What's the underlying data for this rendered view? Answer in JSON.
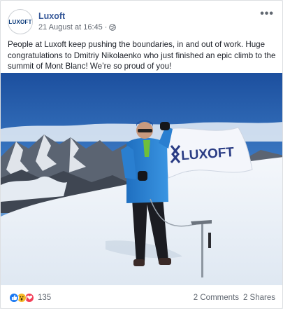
{
  "post": {
    "page_name": "Luxoft",
    "avatar_text": "LUXOFT",
    "timestamp": "21 August at 16:45",
    "separator": "·",
    "privacy_icon": "globe-icon",
    "more_icon": "ellipsis-icon",
    "more_label": "•••",
    "text": "People at Luxoft keep pushing the boundaries, in and out of work. Huge congratulations to Dmitriy Nikolaenko who just finished an epic climb to the summit of Mont Blanc! We’re so proud of you!"
  },
  "photo": {
    "flag_text": "LUXOFT",
    "colors": {
      "sky_top": "#1f58a8",
      "sky_bottom": "#6fa5d8",
      "snow": "#eef3f8",
      "jacket": "#2e86d6",
      "flag": "#f4f6fb",
      "flag_text": "#2a3c84"
    }
  },
  "footer": {
    "reactions": [
      "like-icon",
      "wow-icon",
      "love-icon"
    ],
    "reaction_count": "135",
    "comments": "2 Comments",
    "shares": "2 Shares"
  }
}
